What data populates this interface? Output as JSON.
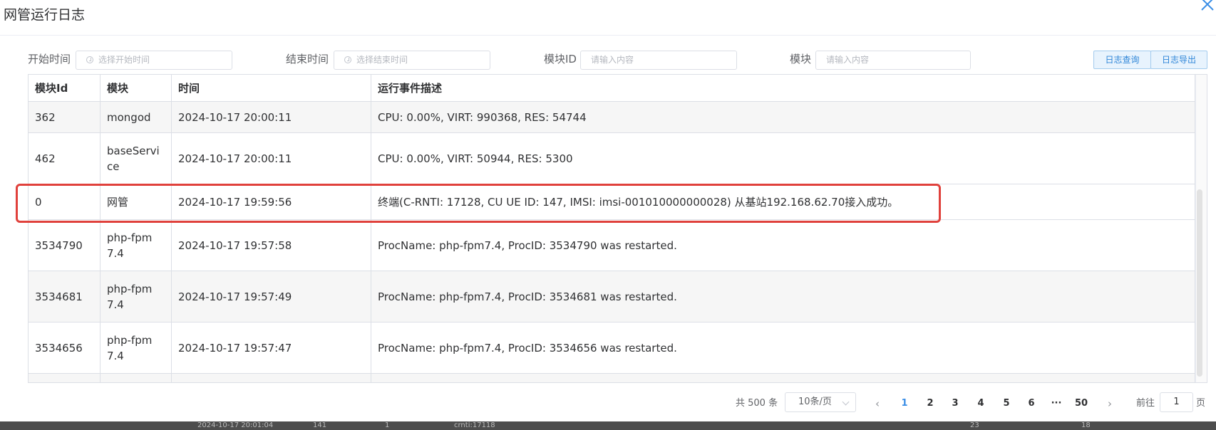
{
  "dialog": {
    "title": "网管运行日志"
  },
  "filters": {
    "start_label": "开始时间",
    "start_placeholder": "选择开始时间",
    "end_label": "结束时间",
    "end_placeholder": "选择结束时间",
    "module_id_label": "模块ID",
    "module_id_placeholder": "请输入内容",
    "module_label": "模块",
    "module_placeholder": "请输入内容",
    "query_button": "日志查询",
    "export_button": "日志导出"
  },
  "table": {
    "columns": [
      "模块Id",
      "模块",
      "时间",
      "运行事件描述"
    ],
    "rows": [
      {
        "id": "362",
        "module": "mongod",
        "time": "2024-10-17 20:00:11",
        "desc": "CPU: 0.00%, VIRT: 990368, RES: 54744"
      },
      {
        "id": "462",
        "module": "baseService",
        "time": "2024-10-17 20:00:11",
        "desc": "CPU: 0.00%, VIRT: 50944, RES: 5300"
      },
      {
        "id": "0",
        "module": "网管",
        "time": "2024-10-17 19:59:56",
        "desc": "终端(C-RNTI: 17128, CU UE ID: 147, IMSI: imsi-001010000000028) 从基站192.168.62.70接入成功。"
      },
      {
        "id": "3534790",
        "module": "php-fpm7.4",
        "time": "2024-10-17 19:57:58",
        "desc": "ProcName: php-fpm7.4, ProcID: 3534790 was restarted."
      },
      {
        "id": "3534681",
        "module": "php-fpm7.4",
        "time": "2024-10-17 19:57:49",
        "desc": "ProcName: php-fpm7.4, ProcID: 3534681 was restarted."
      },
      {
        "id": "3534656",
        "module": "php-fpm7.4",
        "time": "2024-10-17 19:57:47",
        "desc": "ProcName: php-fpm7.4, ProcID: 3534656 was restarted."
      }
    ]
  },
  "pagination": {
    "total": "共 500 条",
    "page_size": "10条/页",
    "pages": [
      "1",
      "2",
      "3",
      "4",
      "5",
      "6",
      "···",
      "50"
    ],
    "current": "1",
    "goto_label": "前往",
    "goto_value": "1",
    "page_suffix": "页"
  },
  "background": {
    "time": "2024-10-17 20:01:04",
    "c1": "141",
    "c2": "1",
    "c3": "crnti:17118",
    "c4": "23",
    "c5": "18"
  },
  "colors": {
    "accent": "#3a8ee6",
    "highlight": "#e0413c",
    "stripe": "#f6f6f6"
  }
}
